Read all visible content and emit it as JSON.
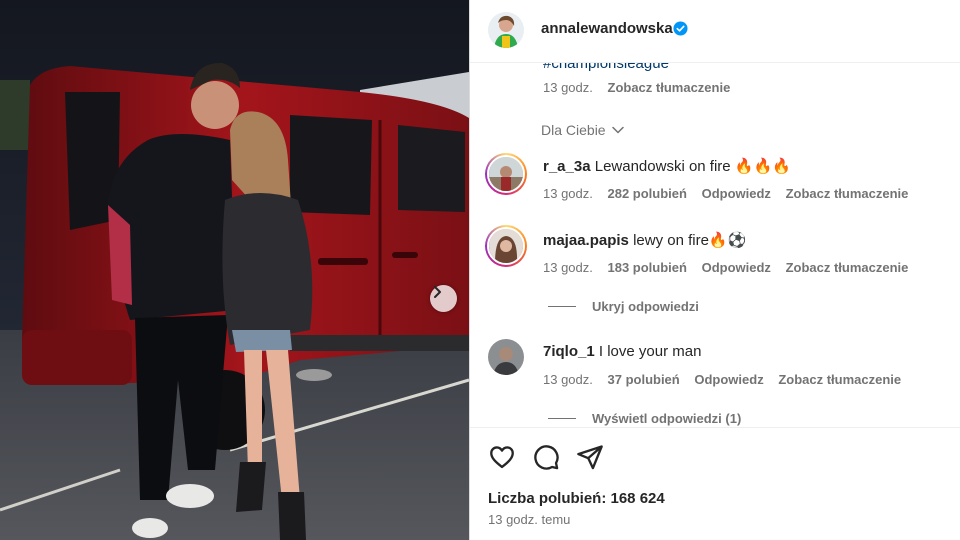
{
  "header": {
    "username": "annalewandowska"
  },
  "caption": {
    "hashtag": "#championsleague",
    "time": "13 godz.",
    "translate": "Zobacz tłumaczenie"
  },
  "filter": {
    "label": "Dla Ciebie"
  },
  "comments": [
    {
      "user": "r_a_3a",
      "text": "Lewandowski on fire 🔥🔥🔥",
      "time": "13 godz.",
      "likes": "282 polubień",
      "reply": "Odpowiedz",
      "translate": "Zobacz tłumaczenie"
    },
    {
      "user": "majaa.papis",
      "text": "lewy on fire🔥⚽",
      "time": "13 godz.",
      "likes": "183 polubień",
      "reply": "Odpowiedz",
      "translate": "Zobacz tłumaczenie",
      "replies_toggle": "Ukryj odpowiedzi"
    },
    {
      "user": "7iqlo_1",
      "text": "I love your man",
      "time": "13 godz.",
      "likes": "37 polubień",
      "reply": "Odpowiedz",
      "translate": "Zobacz tłumaczenie",
      "replies_toggle": "Wyświetl odpowiedzi (1)"
    }
  ],
  "footer": {
    "likes": "Liczba polubień: 168 624",
    "time": "13 godz. temu"
  },
  "icons": {
    "like": "heart-icon",
    "comment": "comment-icon",
    "share": "share-icon",
    "next": "chevron-right-icon",
    "verified": "verified-badge-icon",
    "filter": "chevron-down-icon"
  },
  "colors": {
    "verified": "#0095f6",
    "link": "#00376b",
    "muted": "#737373",
    "text": "#262626"
  }
}
